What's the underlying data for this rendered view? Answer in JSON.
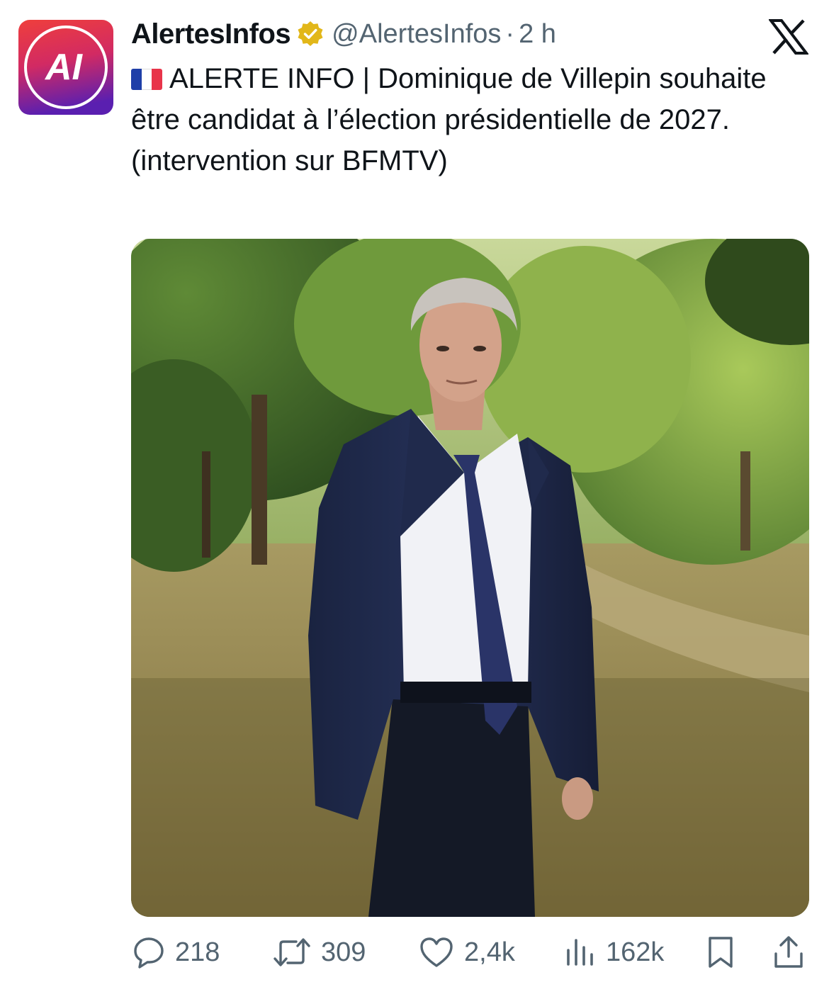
{
  "tweet": {
    "display_name": "AlertesInfos",
    "handle": "@AlertesInfos",
    "separator": "·",
    "timestamp": "2 h",
    "avatar_text": "AI",
    "flag": "🇫🇷",
    "text": "ALERTE INFO | Dominique de Villepin souhaite être candidat à l’élection présidentielle de 2027. (intervention sur BFMTV)",
    "image_icon": "photo-man-in-suit-in-park"
  },
  "actions": {
    "replies": "218",
    "reposts": "309",
    "likes": "2,4k",
    "views": "162k"
  },
  "icons": {
    "verified": "verified-badge-icon",
    "platform": "x-logo-icon",
    "reply": "reply-icon",
    "repost": "repost-icon",
    "like": "heart-icon",
    "views": "views-chart-icon",
    "bookmark": "bookmark-icon",
    "share": "share-icon"
  },
  "colors": {
    "text_primary": "#0f1419",
    "text_secondary": "#536471",
    "verified_gold": "#e2b719",
    "avatar_red": "#e8344a",
    "avatar_purple": "#5a1fb0"
  }
}
